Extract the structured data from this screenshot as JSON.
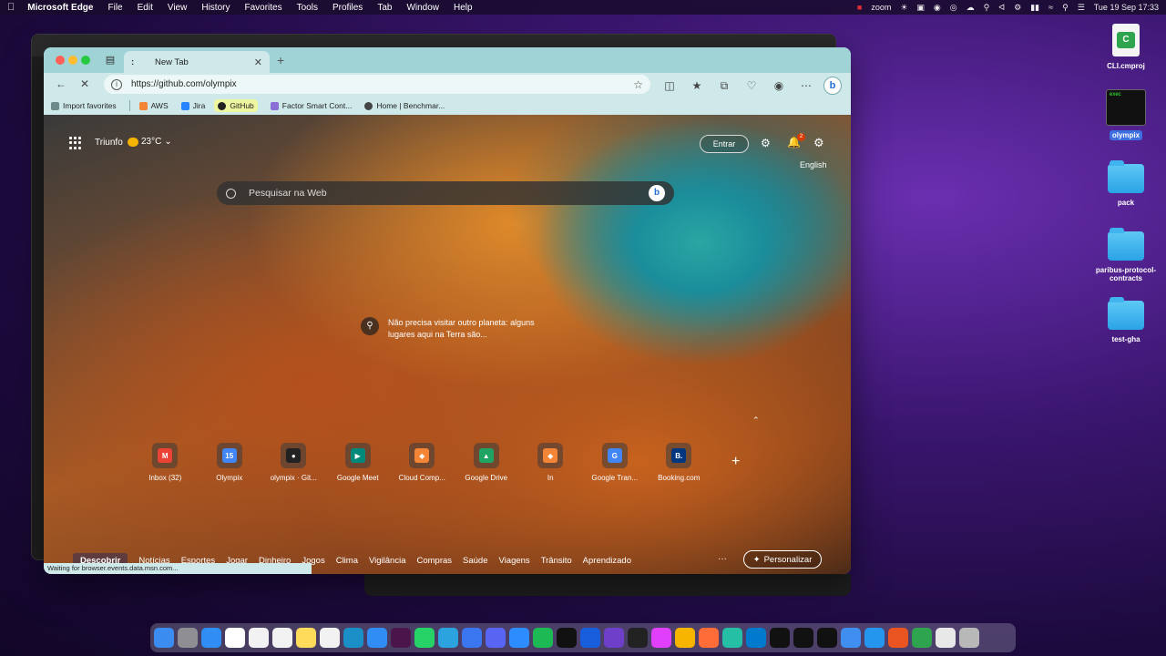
{
  "menubar": {
    "app_name": "Microsoft Edge",
    "items": [
      "File",
      "Edit",
      "View",
      "History",
      "Favorites",
      "Tools",
      "Profiles",
      "Tab",
      "Window",
      "Help"
    ],
    "zoom_label": "zoom",
    "clock": "Tue 19 Sep  17:33"
  },
  "browser": {
    "tab_title": "New Tab",
    "tab_dots": ":",
    "url": "https://github.com/olympix",
    "favorites": [
      {
        "label": "Import favorites",
        "color": "#6f8a8a"
      },
      {
        "label": "AWS",
        "color": "#f58536"
      },
      {
        "label": "Jira",
        "color": "#2684ff"
      },
      {
        "label": "GitHub",
        "color": "#222222"
      },
      {
        "label": "Factor Smart Cont...",
        "color": "#8a6fd6"
      },
      {
        "label": "Home | Benchmar...",
        "color": "#444444"
      }
    ],
    "status_text": "Waiting for browser.events.data.msn.com..."
  },
  "newtab": {
    "location": "Triunfo",
    "temperature": "23°C",
    "signin_label": "Entrar",
    "notification_count": "2",
    "language": "English",
    "search_placeholder": "Pesquisar na Web",
    "caption": "Não precisa visitar outro planeta: alguns lugares aqui na Terra são...",
    "quick_links": [
      {
        "label": "Inbox (32)",
        "glyph": "M",
        "color": "#ea4335"
      },
      {
        "label": "Olympix",
        "glyph": "15",
        "color": "#4285f4"
      },
      {
        "label": "olympix · Git...",
        "glyph": "●",
        "color": "#222222"
      },
      {
        "label": "Google Meet",
        "glyph": "▶",
        "color": "#00897b"
      },
      {
        "label": "Cloud Comp...",
        "glyph": "◆",
        "color": "#f58536"
      },
      {
        "label": "Google Drive",
        "glyph": "▲",
        "color": "#1fa463"
      },
      {
        "label": "In",
        "glyph": "◆",
        "color": "#f58536"
      },
      {
        "label": "Google Tran...",
        "glyph": "G",
        "color": "#4285f4"
      },
      {
        "label": "Booking.com",
        "glyph": "B.",
        "color": "#003580"
      }
    ],
    "feed_tabs": [
      "Descobrir",
      "Notícias",
      "Esportes",
      "Jogar",
      "Dinheiro",
      "Jogos",
      "Clima",
      "Vigilância",
      "Compras",
      "Saúde",
      "Viagens",
      "Trânsito",
      "Aprendizado"
    ],
    "feed_more": "···",
    "personalize_label": "Personalizar"
  },
  "desktop": {
    "icons": [
      {
        "label": "CLI.cmproj",
        "kind": "doc"
      },
      {
        "label": "olympix",
        "kind": "exec"
      },
      {
        "label": "pack",
        "kind": "folder"
      },
      {
        "label": "paribus-protocol-contracts",
        "kind": "folder"
      },
      {
        "label": "test-gha",
        "kind": "folder"
      }
    ],
    "exec_text": "exec"
  },
  "dock": {
    "apps": [
      {
        "name": "finder",
        "color": "#3b8cf0"
      },
      {
        "name": "launchpad",
        "color": "#8e8e93"
      },
      {
        "name": "mail",
        "color": "#2f8df3"
      },
      {
        "name": "calendar",
        "color": "#ffffff"
      },
      {
        "name": "reminders",
        "color": "#f2f2f2"
      },
      {
        "name": "chrome",
        "color": "#f2f2f2"
      },
      {
        "name": "notes",
        "color": "#fedb5b"
      },
      {
        "name": "freeform",
        "color": "#f2f2f2"
      },
      {
        "name": "edge",
        "color": "#1a8fc7"
      },
      {
        "name": "safari",
        "color": "#2f8df3"
      },
      {
        "name": "slack",
        "color": "#4a154b"
      },
      {
        "name": "whatsapp",
        "color": "#25d366"
      },
      {
        "name": "telegram",
        "color": "#2aa3df"
      },
      {
        "name": "signal",
        "color": "#3a76f0"
      },
      {
        "name": "discord",
        "color": "#5865f2"
      },
      {
        "name": "zoom",
        "color": "#2d8cff"
      },
      {
        "name": "spotify",
        "color": "#1db954"
      },
      {
        "name": "tidal",
        "color": "#111111"
      },
      {
        "name": "bitwarden",
        "color": "#175ddc"
      },
      {
        "name": "github-desktop",
        "color": "#6e40c9"
      },
      {
        "name": "terminal-app",
        "color": "#222222"
      },
      {
        "name": "flower-app",
        "color": "#e040fb"
      },
      {
        "name": "sketch-app",
        "color": "#f7b500"
      },
      {
        "name": "postman",
        "color": "#ff6c37"
      },
      {
        "name": "vscode-insiders",
        "color": "#24bfa5"
      },
      {
        "name": "vscode",
        "color": "#007acc"
      },
      {
        "name": "webstorm",
        "color": "#111111"
      },
      {
        "name": "pycharm",
        "color": "#111111"
      },
      {
        "name": "rider",
        "color": "#111111"
      },
      {
        "name": "simulator",
        "color": "#3f8ef0"
      },
      {
        "name": "docker",
        "color": "#2496ed"
      },
      {
        "name": "ubuntu",
        "color": "#e95420"
      },
      {
        "name": "camtasia",
        "color": "#2ea44f"
      },
      {
        "name": "documents",
        "color": "#e8e8e8"
      },
      {
        "name": "trash",
        "color": "#b8b8b8"
      }
    ]
  }
}
